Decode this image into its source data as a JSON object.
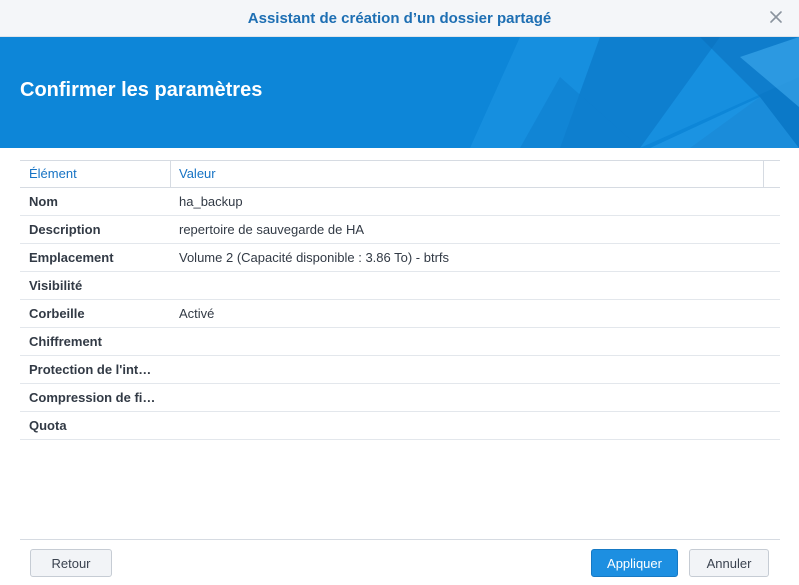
{
  "window": {
    "title": "Assistant de création d’un dossier partagé",
    "close_icon": "close-icon"
  },
  "banner": {
    "heading": "Confirmer les paramètres",
    "color": "#0d86d8"
  },
  "table": {
    "headers": {
      "key": "Élément",
      "value": "Valeur"
    },
    "rows": [
      {
        "key": "Nom",
        "value": "ha_backup"
      },
      {
        "key": "Description",
        "value": "repertoire de sauvegarde de HA"
      },
      {
        "key": "Emplacement",
        "value": "Volume 2 (Capacité disponible : 3.86 To) - btrfs"
      },
      {
        "key": "Visibilité",
        "value": ""
      },
      {
        "key": "Corbeille",
        "value": "Activé"
      },
      {
        "key": "Chiffrement",
        "value": ""
      },
      {
        "key": "Protection de l'int…",
        "value": ""
      },
      {
        "key": "Compression de fi…",
        "value": ""
      },
      {
        "key": "Quota",
        "value": ""
      }
    ]
  },
  "footer": {
    "back_label": "Retour",
    "apply_label": "Appliquer",
    "cancel_label": "Annuler"
  }
}
